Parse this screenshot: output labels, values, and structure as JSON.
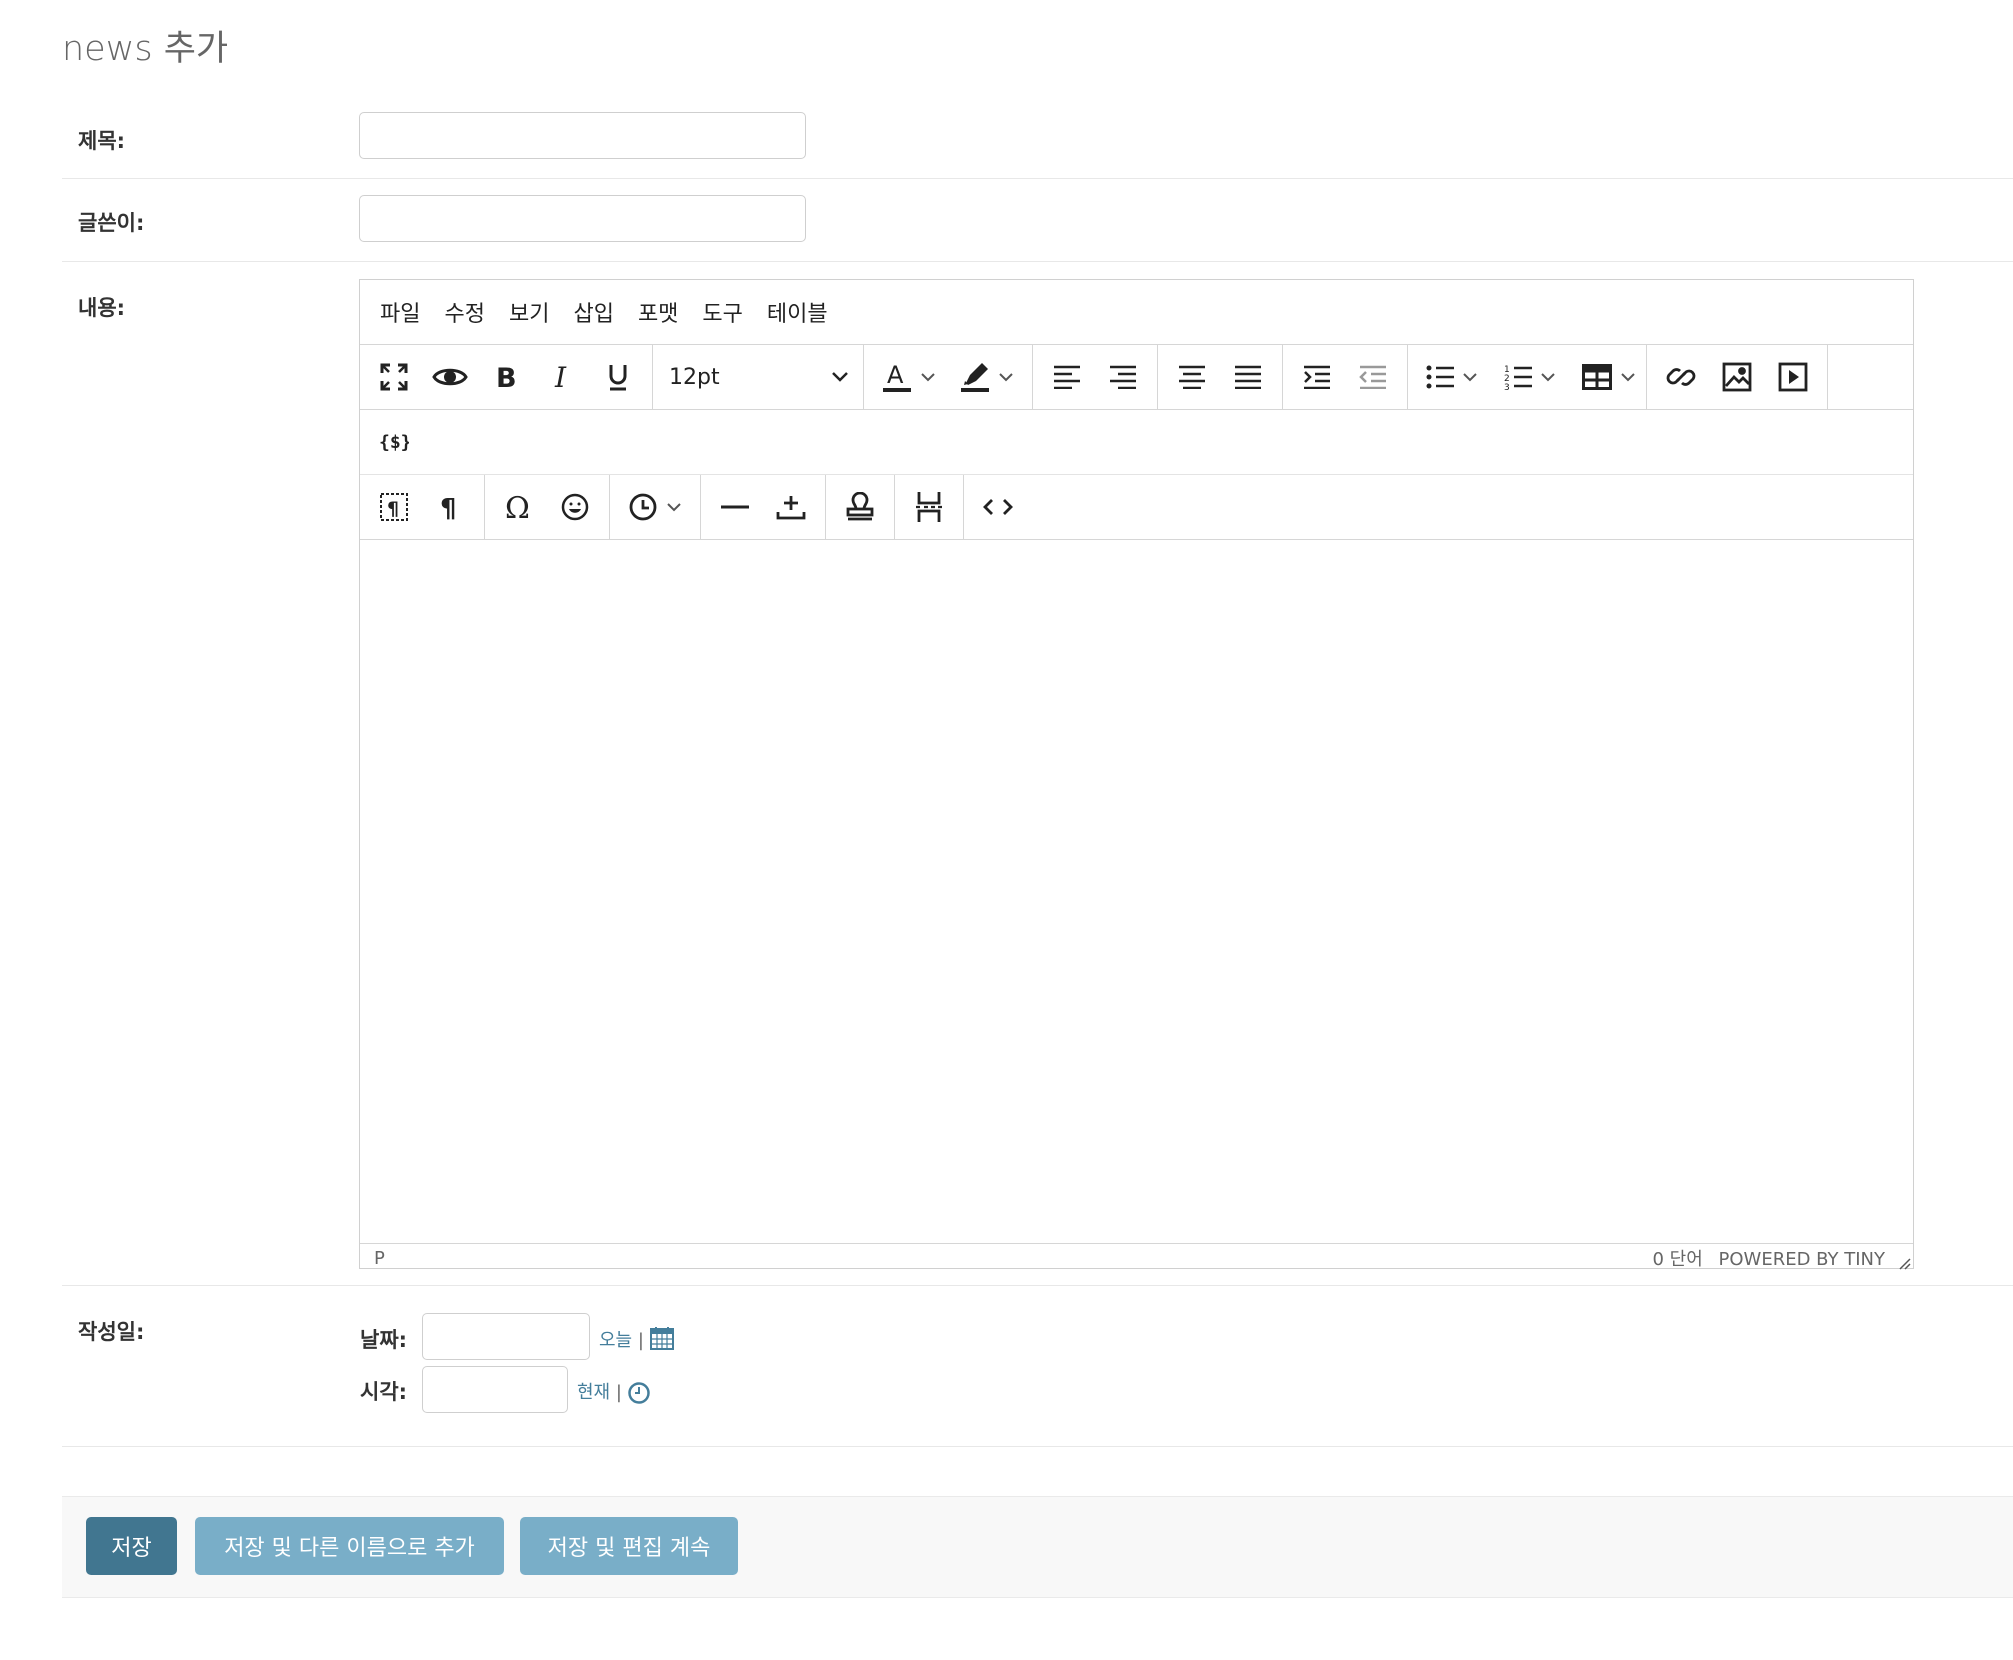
{
  "page": {
    "title": "news 추가"
  },
  "fields": {
    "title_label": "제목:",
    "author_label": "글쓴이:",
    "content_label": "내용:",
    "date_label": "작성일:"
  },
  "editor": {
    "menu": [
      "파일",
      "수정",
      "보기",
      "삽입",
      "포맷",
      "도구",
      "테이블"
    ],
    "font_size": "12pt",
    "status_path": "P",
    "word_count": "0 단어",
    "powered_by": "POWERED BY TINY",
    "toolbar_icons": [
      "fullscreen-icon",
      "preview-icon",
      "bold-icon",
      "italic-icon",
      "underline-icon",
      "text-color-icon",
      "highlight-icon",
      "align-left-icon",
      "align-right-icon",
      "align-center-icon",
      "align-justify-icon",
      "indent-icon",
      "outdent-icon",
      "bullet-list-icon",
      "numbered-list-icon",
      "table-icon",
      "link-icon",
      "image-icon",
      "media-icon",
      "template-icon",
      "visual-blocks-icon",
      "paragraph-mark-icon",
      "special-char-icon",
      "emoji-icon",
      "datetime-icon",
      "horizontal-rule-icon",
      "insert-anchor-icon",
      "stamp-icon",
      "page-break-icon",
      "code-icon"
    ]
  },
  "datetime": {
    "date_label": "날짜:",
    "time_label": "시각:",
    "today_link": "오늘",
    "now_link": "현재",
    "separator": "|"
  },
  "buttons": {
    "save": "저장",
    "save_add_another": "저장 및 다른 이름으로 추가",
    "save_continue": "저장 및 편집 계속"
  },
  "colors": {
    "primary": "#417690",
    "secondary": "#79aec8",
    "link": "#447e9b"
  }
}
